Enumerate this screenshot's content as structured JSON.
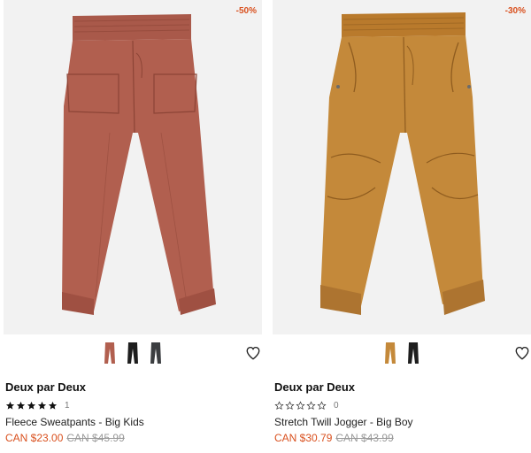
{
  "colors": {
    "sale": "#d9501e",
    "strike": "#9a9a9a",
    "image_bg": "#f2f2f2"
  },
  "products": [
    {
      "discount": "-50%",
      "brand": "Deux par Deux",
      "rating_count": "1",
      "rating": 5,
      "name": "Fleece Sweatpants - Big Kids",
      "sale_price": "CAN $23.00",
      "original_price": "CAN $45.99",
      "swatches": [
        "rust",
        "black",
        "charcoal"
      ],
      "icons": {
        "favorite": "heart-outline-icon",
        "star": "star-icon"
      }
    },
    {
      "discount": "-30%",
      "brand": "Deux par Deux",
      "rating_count": "0",
      "rating": 0,
      "name": "Stretch Twill Jogger - Big Boy",
      "sale_price": "CAN $30.79",
      "original_price": "CAN $43.99",
      "swatches": [
        "camel",
        "black"
      ],
      "icons": {
        "favorite": "heart-outline-icon",
        "star": "star-outline-icon"
      }
    }
  ]
}
